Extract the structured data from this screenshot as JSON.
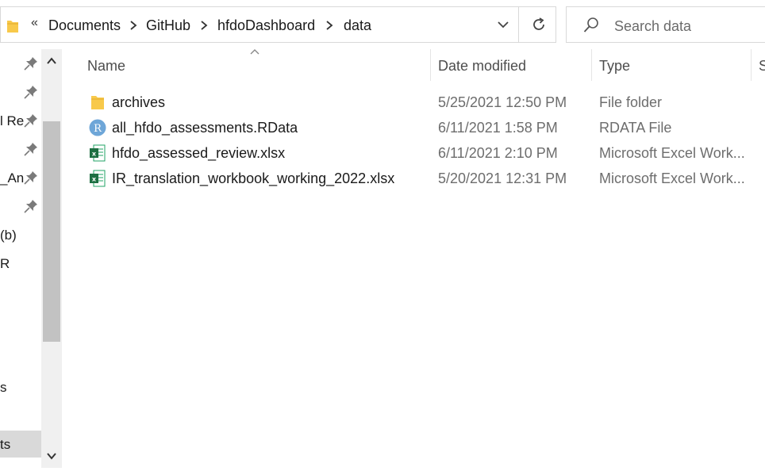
{
  "address_bar": {
    "overflow_chevron": "«",
    "breadcrumbs": [
      "Documents",
      "GitHub",
      "hfdoDashboard",
      "data"
    ]
  },
  "search": {
    "placeholder": "Search data"
  },
  "sidebar": {
    "fragments": [
      "l Re",
      "_An",
      "(b)",
      "R",
      "s",
      "ts"
    ]
  },
  "columns": {
    "name": "Name",
    "date_modified": "Date modified",
    "type": "Type",
    "size_partial": "S"
  },
  "files": [
    {
      "name": "archives",
      "date": "5/25/2021 12:50 PM",
      "type": "File folder",
      "icon": "folder-icon"
    },
    {
      "name": "all_hfdo_assessments.RData",
      "date": "6/11/2021 1:58 PM",
      "type": "RDATA File",
      "icon": "r-file-icon"
    },
    {
      "name": "hfdo_assessed_review.xlsx",
      "date": "6/11/2021 2:10 PM",
      "type": "Microsoft Excel Work...",
      "icon": "excel-file-icon"
    },
    {
      "name": "IR_translation_workbook_working_2022.xlsx",
      "date": "5/20/2021 12:31 PM",
      "type": "Microsoft Excel Work...",
      "icon": "excel-file-icon"
    }
  ],
  "colors": {
    "folder": "#f8c94a",
    "excel": "#1d6f42",
    "r_icon": "#6ea6d8",
    "selected_bg": "#d9d9d9"
  }
}
